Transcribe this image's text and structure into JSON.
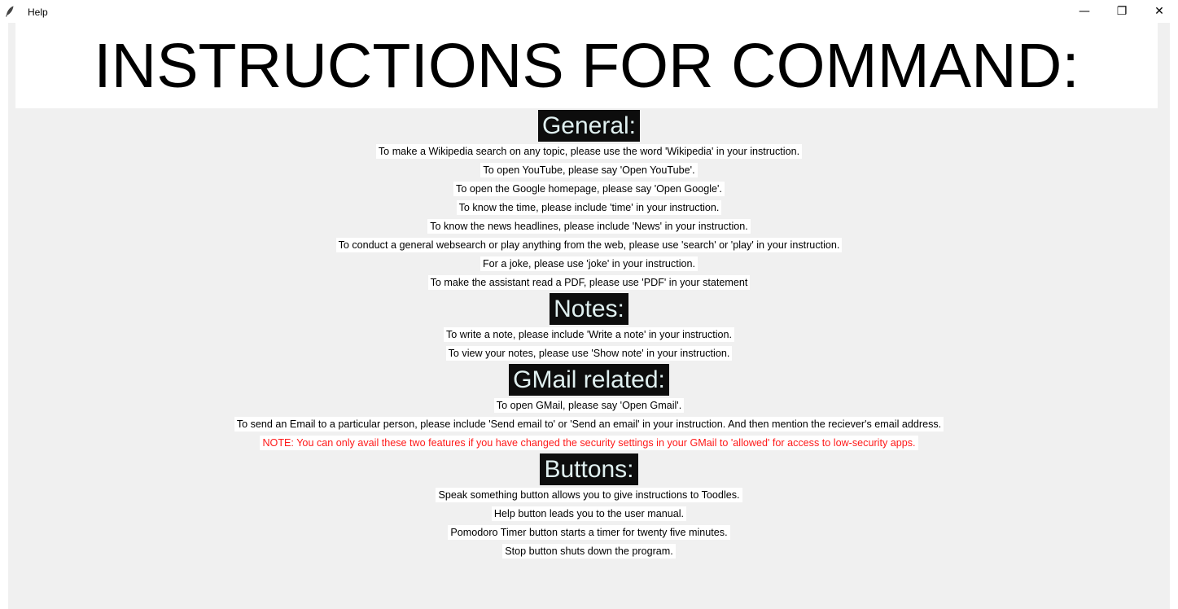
{
  "window": {
    "title": "Help",
    "controls": {
      "minimize": "—",
      "restore": "❐",
      "close": "✕"
    },
    "icon": "feather-icon"
  },
  "main_heading": "INSTRUCTIONS FOR COMMAND:",
  "sections": [
    {
      "heading": "General:",
      "lines": [
        "To make a Wikipedia search on any topic, please use the word 'Wikipedia' in your instruction.",
        "To open YouTube, please say 'Open YouTube'.",
        "To open the Google homepage, please say 'Open Google'.",
        "To know the time, please include 'time' in your instruction.",
        "To know the news headlines, please include 'News' in your instruction.",
        "To conduct a general websearch or play anything from the web, please use 'search' or 'play' in your instruction.",
        "For a joke, please use 'joke' in your instruction.",
        "To make the assistant read a PDF, please use 'PDF' in your statement"
      ]
    },
    {
      "heading": "Notes:",
      "lines": [
        "To write a note, please include 'Write a note' in your instruction.",
        "To view your notes, please use 'Show note' in your instruction."
      ]
    },
    {
      "heading": "GMail related:",
      "lines": [
        "To open GMail, please say 'Open Gmail'.",
        "To send an Email to a particular person, please include 'Send email to' or 'Send an email' in your instruction. And then mention the reciever's email address."
      ],
      "note": "NOTE: You can only avail these two features if you have changed the security settings in your GMail to 'allowed' for access to low-security apps."
    },
    {
      "heading": "Buttons:",
      "lines": [
        "Speak something button allows you to give instructions to Toodles.",
        "Help button leads you to the user manual.",
        "Pomodoro Timer button starts a timer for twenty five minutes.",
        "Stop button shuts down the program."
      ]
    }
  ],
  "colors": {
    "section_heading_bg": "#0d0d0d",
    "section_heading_fg": "#e0f0f0",
    "note_text": "#ff1a1a",
    "window_bg": "#f0f0f0"
  }
}
